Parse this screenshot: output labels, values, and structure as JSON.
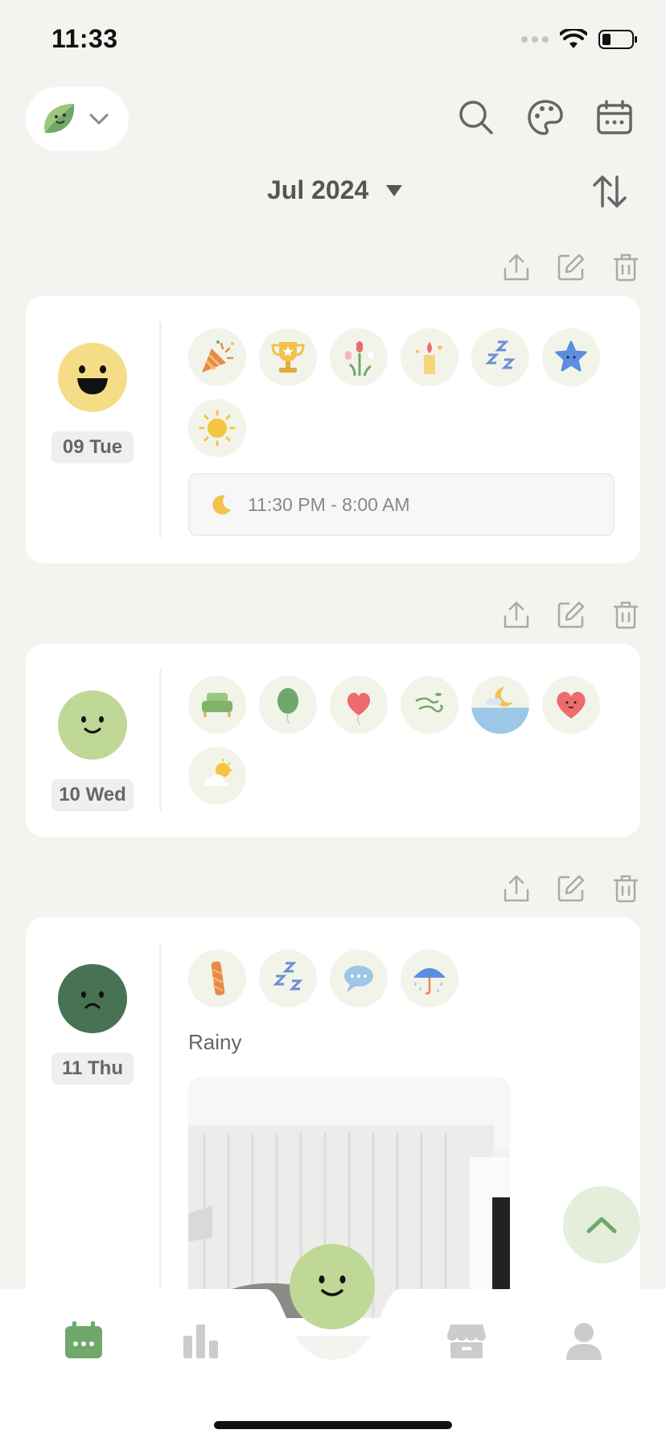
{
  "status": {
    "time": "11:33"
  },
  "header": {
    "month": "Jul 2024",
    "icons": [
      "search-icon",
      "palette-icon",
      "calendar-icon",
      "sort-icon"
    ]
  },
  "entries": [
    {
      "date": "09 Tue",
      "mood": "happy",
      "mood_color": "#f5dd87",
      "activities": [
        "party-popper-icon",
        "trophy-icon",
        "flowers-icon",
        "candle-icon",
        "sleep-zzz-icon",
        "star-icon",
        "sun-icon"
      ],
      "sleep": "11:30 PM - 8:00 AM"
    },
    {
      "date": "10 Wed",
      "mood": "good",
      "mood_color": "#bfd895",
      "activities": [
        "sofa-icon",
        "green-balloon-icon",
        "red-balloon-icon",
        "wind-icon",
        "night-sea-icon",
        "heart-icon",
        "partly-cloudy-icon"
      ]
    },
    {
      "date": "11 Thu",
      "mood": "sad",
      "mood_color": "#477353",
      "activities": [
        "bandage-icon",
        "sleep-zzz-icon",
        "chat-bubble-icon",
        "umbrella-icon"
      ],
      "note": "Rainy"
    }
  ],
  "tabs": [
    "calendar-tab",
    "stats-tab",
    "mood-add-button",
    "store-tab",
    "profile-tab"
  ],
  "colors": {
    "accent": "#6fa86a",
    "background": "#f3f3ef",
    "inactive": "#cccccc"
  }
}
